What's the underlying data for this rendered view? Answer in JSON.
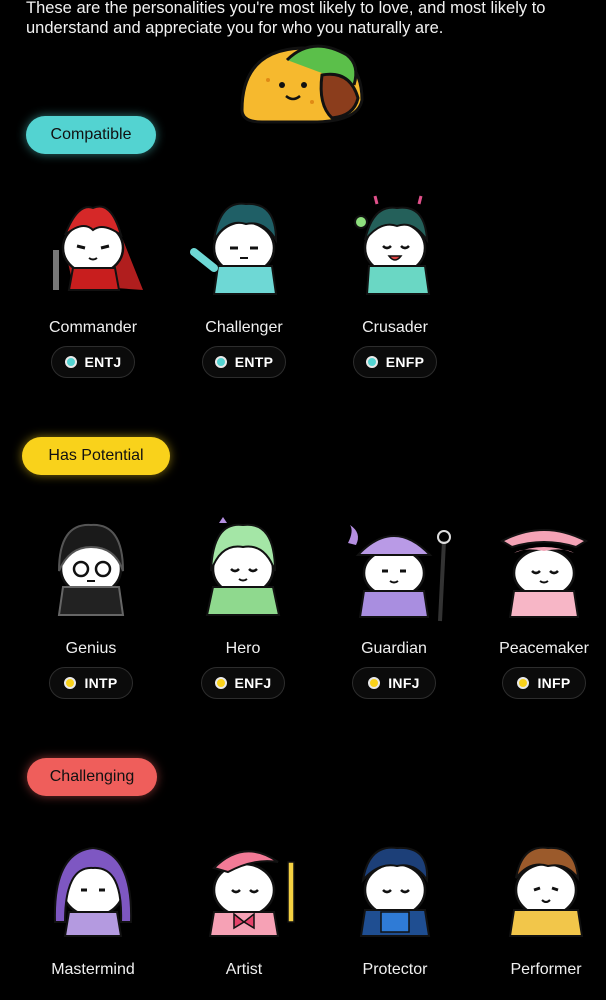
{
  "intro_text": "These are the personalities you're most likely to love, and most likely to understand and appreciate you for who you naturally are.",
  "sections": [
    {
      "label": "Compatible",
      "color": "#53d3d1",
      "cards": [
        {
          "name": "Commander",
          "code": "ENTJ"
        },
        {
          "name": "Challenger",
          "code": "ENTP"
        },
        {
          "name": "Crusader",
          "code": "ENFP"
        }
      ]
    },
    {
      "label": "Has Potential",
      "color": "#f9d21b",
      "cards": [
        {
          "name": "Genius",
          "code": "INTP"
        },
        {
          "name": "Hero",
          "code": "ENFJ"
        },
        {
          "name": "Guardian",
          "code": "INFJ"
        },
        {
          "name": "Peacemaker",
          "code": "INFP"
        }
      ]
    },
    {
      "label": "Challenging",
      "color": "#ef5e5b",
      "cards": [
        {
          "name": "Mastermind"
        },
        {
          "name": "Artist"
        },
        {
          "name": "Protector"
        },
        {
          "name": "Performer"
        }
      ]
    }
  ],
  "icons": [
    "taco-sticker-icon"
  ]
}
